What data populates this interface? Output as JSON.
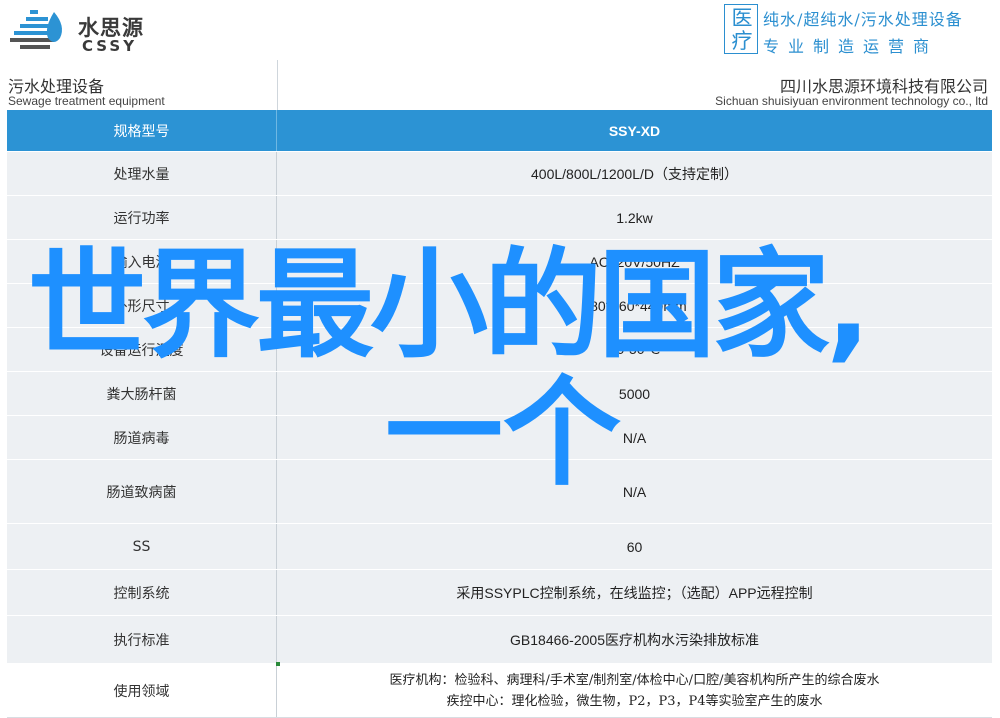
{
  "brand": {
    "name_cn": "水思源",
    "name_en": "CSSY",
    "logo_icon": "water-drop-lines-icon"
  },
  "badge": {
    "char_top": "医",
    "char_bottom": "疗",
    "slogan_line1": "纯水/超纯水/污水处理设备",
    "slogan_line2": "专业制造运营商"
  },
  "title": {
    "left_cn": "污水处理设备",
    "left_en": "Sewage treatment equipment",
    "right_cn": "四川水思源环境科技有限公司",
    "right_en": "Sichuan shuisiyuan environment technology co., ltd"
  },
  "table": {
    "header": {
      "label": "规格型号",
      "value": "SSY-XD"
    },
    "rows": [
      {
        "label": "处理水量",
        "value": "400L/800L/1200L/D（支持定制）"
      },
      {
        "label": "运行功率",
        "value": "1.2kw"
      },
      {
        "label": "输入电源",
        "value": "AC220V/50HZ"
      },
      {
        "label": "外形尺寸",
        "value": "680*460*440mm"
      },
      {
        "label": "设备运行温度",
        "value": "10-50℃"
      },
      {
        "label": "粪大肠杆菌",
        "value": "5000"
      },
      {
        "label": "肠道病毒",
        "value": "N/A"
      },
      {
        "label": "肠道致病菌",
        "value": "N/A"
      },
      {
        "label": "SS",
        "value": "60"
      },
      {
        "label": "控制系统",
        "value": "采用SSYPLC控制系统，在线监控；（选配）APP远程控制"
      },
      {
        "label": "执行标准",
        "value": "GB18466-2005医疗机构水污染排放标准"
      },
      {
        "label": "使用领域",
        "value_line1": "医疗机构：检验科、病理科/手术室/制剂室/体检中心/口腔/美容机构所产生的综合废水",
        "value_line2": "疾控中心：理化检验，微生物，P2，P3，P4等实验室产生的废水"
      }
    ]
  },
  "overlay": {
    "headline_line1": "世界最小的国家,",
    "headline_line2": "一个"
  },
  "colors": {
    "accent": "#2c93d4",
    "headline": "#1e90ff",
    "row_alt": "#edf0f3"
  }
}
